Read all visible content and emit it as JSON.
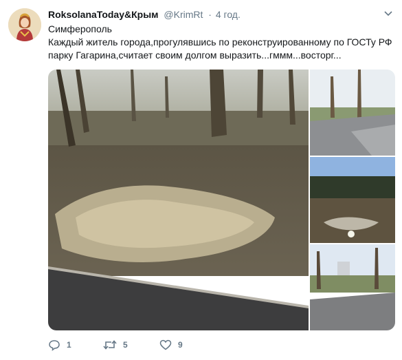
{
  "tweet": {
    "author_name": "RoksolanaToday&Крым",
    "handle": "@KrimRt",
    "separator": "·",
    "time": "4 год.",
    "location": "Симферополь",
    "text_line1": "Каждый житель города,прогулявшись по реконструированному по ГОСТу РФ",
    "text_line2": "парку Гагарина,считает своим долгом выразить...гммм...восторг..."
  },
  "actions": {
    "replies": "1",
    "retweets": "5",
    "likes": "9"
  },
  "icons": {
    "menu": "chevron-down-icon",
    "reply": "reply-icon",
    "retweet": "retweet-icon",
    "like": "heart-icon"
  },
  "colors": {
    "text": "#14171a",
    "secondary": "#657786"
  }
}
